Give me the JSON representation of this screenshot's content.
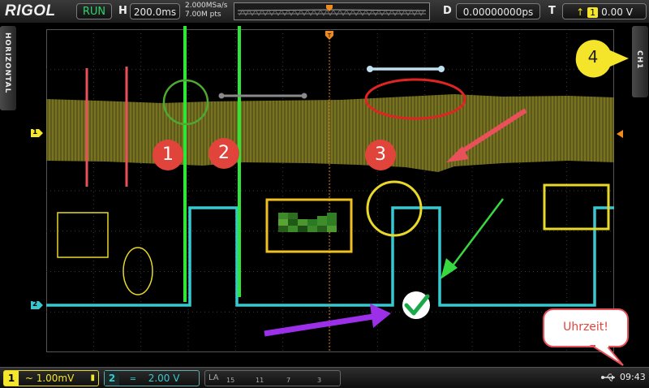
{
  "topbar": {
    "logo": "RIGOL",
    "run_state": "RUN",
    "h_label": "H",
    "timebase": "200.0ms",
    "sample_rate": "2.000MSa/s",
    "mem_depth": "7.00M pts",
    "d_label": "D",
    "delay": "0.00000000ps",
    "t_label": "T",
    "trigger_source": "1",
    "trigger_level": "0.00 V"
  },
  "side": {
    "left_tab": "HORIZONTAL",
    "right_tab": "CH1",
    "ch1_marker": "1",
    "ch2_marker": "2"
  },
  "annotations": {
    "num1": "1",
    "num2": "2",
    "num3": "3",
    "num4": "4",
    "callout": "Uhrzeit!"
  },
  "bottombar": {
    "ch1_num": "1",
    "ch1_scale": "~ 1.00mV",
    "ch2_num": "2",
    "ch2_scale": "2.00 V",
    "la_label": "LA",
    "la_ticks": [
      "15",
      "11",
      "7",
      "3"
    ],
    "clock": "09:43"
  },
  "colors": {
    "ch1": "#f4e62a",
    "ch2": "#38c9d0",
    "run": "#2fd36c",
    "trigger_marker": "#f08a1e"
  },
  "icons": [
    "trigger-edge-icon",
    "usb-icon",
    "checkmark-icon"
  ]
}
